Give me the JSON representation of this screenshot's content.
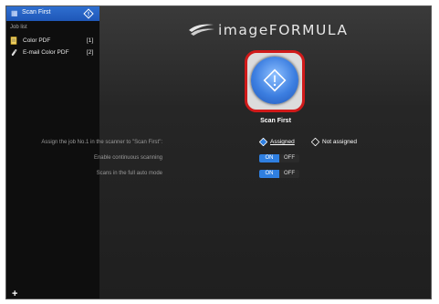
{
  "sidebar": {
    "header_title": "Scan First",
    "job_list_label": "Job list",
    "jobs": [
      {
        "name": "Color PDF",
        "number": "[1]",
        "icon": "document-icon"
      },
      {
        "name": "E-mail Color PDF",
        "number": "[2]",
        "icon": "paperclip-icon"
      }
    ],
    "add_label": "+"
  },
  "logo": {
    "text": "imageFORMULA"
  },
  "scan_first": {
    "label": "Scan First"
  },
  "settings": {
    "assign_label": "Assign the job No.1 in the scanner to \"Scan First\":",
    "assigned_label": "Assigned",
    "not_assigned_label": "Not assigned",
    "continuous_label": "Enable continuous scanning",
    "full_auto_label": "Scans in the full auto mode",
    "on_label": "ON",
    "off_label": "OFF"
  },
  "colors": {
    "accent": "#2f7fe0",
    "highlight": "#d01a1a"
  }
}
